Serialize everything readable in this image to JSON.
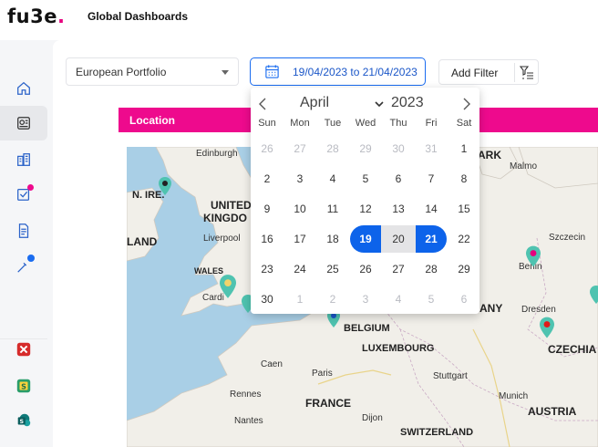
{
  "app": {
    "logo_main": "fu3e",
    "logo_dot": ".",
    "title": "Global Dashboards"
  },
  "sidebar": {
    "items": [
      {
        "name": "home",
        "icon": "home-icon"
      },
      {
        "name": "dashboard",
        "icon": "dashboard-icon",
        "active": true
      },
      {
        "name": "buildings",
        "icon": "buildings-icon"
      },
      {
        "name": "tasks",
        "icon": "checklist-icon",
        "badge_color": "#ee0a8d"
      },
      {
        "name": "reports",
        "icon": "document-icon"
      },
      {
        "name": "tools",
        "icon": "pipette-icon",
        "badge_color": "#1a6cf0"
      }
    ],
    "apps": [
      {
        "name": "app-x",
        "icon": "x-app-icon",
        "color": "#d62b2b"
      },
      {
        "name": "app-s",
        "icon": "s-app-icon",
        "color": "#2a9d6a"
      },
      {
        "name": "sharepoint",
        "icon": "sharepoint-icon",
        "color": "#0f7a7a"
      }
    ]
  },
  "filters": {
    "portfolio": "European Portfolio",
    "date_range": "19/04/2023 to 21/04/2023",
    "add_filter": "Add Filter"
  },
  "location": {
    "title": "Location"
  },
  "calendar": {
    "month": "April",
    "year": "2023",
    "weekdays": [
      "Sun",
      "Mon",
      "Tue",
      "Wed",
      "Thu",
      "Fri",
      "Sat"
    ],
    "weeks": [
      [
        [
          "26",
          "muted"
        ],
        [
          "27",
          "muted"
        ],
        [
          "28",
          "muted"
        ],
        [
          "29",
          "muted"
        ],
        [
          "30",
          "muted"
        ],
        [
          "31",
          "muted"
        ],
        [
          "1",
          ""
        ]
      ],
      [
        [
          "2",
          ""
        ],
        [
          "3",
          ""
        ],
        [
          "4",
          ""
        ],
        [
          "5",
          ""
        ],
        [
          "6",
          ""
        ],
        [
          "7",
          ""
        ],
        [
          "8",
          ""
        ]
      ],
      [
        [
          "9",
          ""
        ],
        [
          "10",
          ""
        ],
        [
          "11",
          ""
        ],
        [
          "12",
          ""
        ],
        [
          "13",
          ""
        ],
        [
          "14",
          ""
        ],
        [
          "15",
          ""
        ]
      ],
      [
        [
          "16",
          ""
        ],
        [
          "17",
          ""
        ],
        [
          "18",
          ""
        ],
        [
          "19",
          "start"
        ],
        [
          "20",
          "range"
        ],
        [
          "21",
          "end"
        ],
        [
          "22",
          ""
        ]
      ],
      [
        [
          "23",
          ""
        ],
        [
          "24",
          ""
        ],
        [
          "25",
          ""
        ],
        [
          "26",
          ""
        ],
        [
          "27",
          ""
        ],
        [
          "28",
          ""
        ],
        [
          "29",
          ""
        ]
      ],
      [
        [
          "30",
          ""
        ],
        [
          "1",
          "muted"
        ],
        [
          "2",
          "muted"
        ],
        [
          "3",
          "muted"
        ],
        [
          "4",
          "muted"
        ],
        [
          "5",
          "muted"
        ],
        [
          "6",
          "muted"
        ]
      ]
    ]
  },
  "map": {
    "labels": [
      {
        "text": "Edinburgh",
        "cls": ""
      },
      {
        "text": "N. IRE.",
        "cls": "big"
      },
      {
        "text": "UNITED",
        "cls": "country"
      },
      {
        "text": "KINGDO",
        "cls": "country"
      },
      {
        "text": "LAND",
        "cls": "country"
      },
      {
        "text": "Liverpool",
        "cls": ""
      },
      {
        "text": "WALES",
        "cls": "big"
      },
      {
        "text": "Cardi",
        "cls": ""
      },
      {
        "text": "ARK",
        "cls": "country"
      },
      {
        "text": "Malmo",
        "cls": ""
      },
      {
        "text": "Szczecin",
        "cls": ""
      },
      {
        "text": "Berlin",
        "cls": ""
      },
      {
        "text": "ANY",
        "cls": "country"
      },
      {
        "text": "Dresden",
        "cls": ""
      },
      {
        "text": "BELGIUM",
        "cls": "big"
      },
      {
        "text": "LUXEMBOURG",
        "cls": "big"
      },
      {
        "text": "CZECHIA",
        "cls": "country"
      },
      {
        "text": "Caen",
        "cls": ""
      },
      {
        "text": "Paris",
        "cls": ""
      },
      {
        "text": "Stuttgart",
        "cls": ""
      },
      {
        "text": "Rennes",
        "cls": ""
      },
      {
        "text": "FRANCE",
        "cls": "country"
      },
      {
        "text": "Munich",
        "cls": ""
      },
      {
        "text": "AUSTRIA",
        "cls": "country"
      },
      {
        "text": "Nantes",
        "cls": ""
      },
      {
        "text": "Dijon",
        "cls": ""
      },
      {
        "text": "SWITZERLAND",
        "cls": "big"
      }
    ]
  },
  "colors": {
    "accent": "#ee0a8d",
    "primary": "#0d63ea",
    "pin_teal": "#4fc3b0"
  }
}
